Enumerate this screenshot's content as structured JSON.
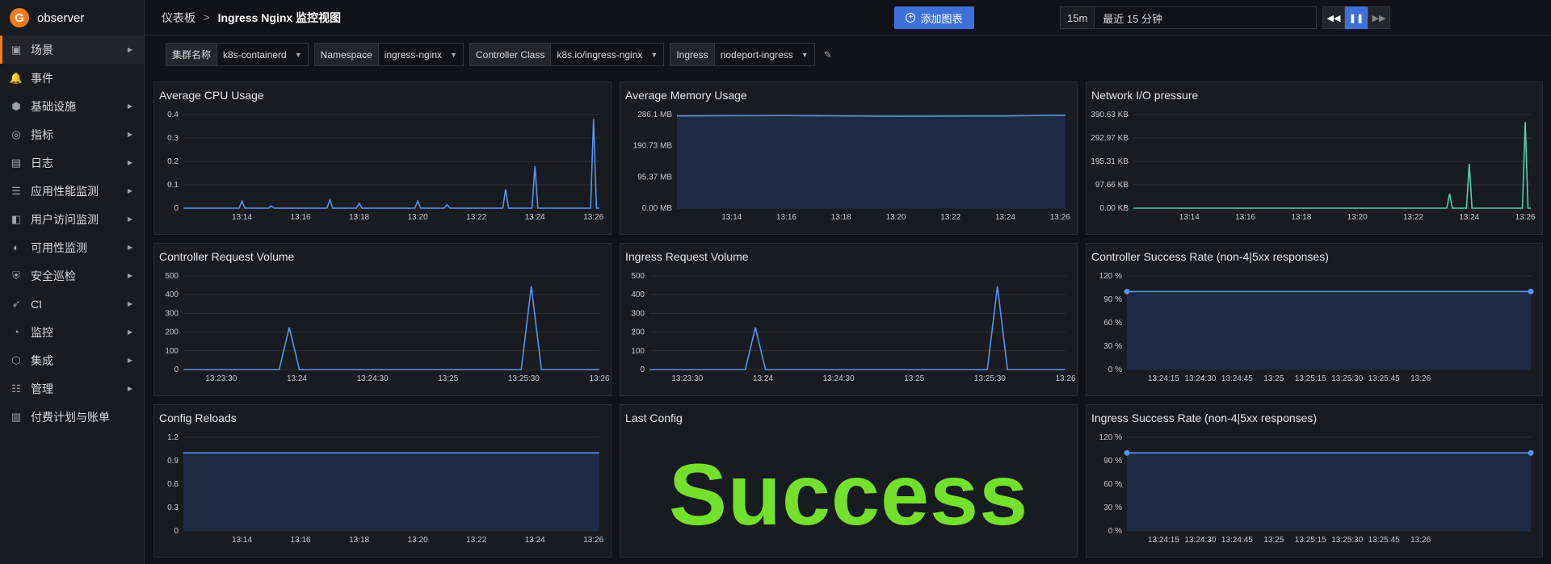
{
  "app": {
    "name": "observer",
    "logo_letter": "G"
  },
  "sidebar": {
    "items": [
      {
        "label": "场景",
        "icon": "scene-icon",
        "glyph": "▣",
        "caret": true,
        "active": true
      },
      {
        "label": "事件",
        "icon": "bell-icon",
        "glyph": "🔔",
        "caret": false
      },
      {
        "label": "基础设施",
        "icon": "infra-icon",
        "glyph": "⬢",
        "caret": true
      },
      {
        "label": "指标",
        "icon": "metrics-icon",
        "glyph": "◎",
        "caret": true
      },
      {
        "label": "日志",
        "icon": "log-icon",
        "glyph": "▤",
        "caret": true
      },
      {
        "label": "应用性能监测",
        "icon": "apm-icon",
        "glyph": "☰",
        "caret": true
      },
      {
        "label": "用户访问监测",
        "icon": "rum-icon",
        "glyph": "◧",
        "caret": true
      },
      {
        "label": "可用性监测",
        "icon": "availability-icon",
        "glyph": "◐",
        "caret": true
      },
      {
        "label": "安全巡检",
        "icon": "shield-icon",
        "glyph": "⛨",
        "caret": true
      },
      {
        "label": "CI",
        "icon": "rocket-icon",
        "glyph": "➶",
        "caret": true
      },
      {
        "label": "监控",
        "icon": "monitor-icon",
        "glyph": "◔",
        "caret": true
      },
      {
        "label": "集成",
        "icon": "integration-icon",
        "glyph": "⬡",
        "caret": true
      },
      {
        "label": "管理",
        "icon": "settings-sliders-icon",
        "glyph": "☷",
        "caret": true
      },
      {
        "label": "付费计划与账单",
        "icon": "billing-icon",
        "glyph": "▥",
        "caret": false
      }
    ]
  },
  "header": {
    "breadcrumb_root": "仪表板",
    "breadcrumb_sep": ">",
    "title": "Ingress Nginx 监控视图",
    "add_chart_label": "添加图表",
    "time_chip": "15m",
    "time_range": "最近 15 分钟"
  },
  "filters": [
    {
      "label": "集群名称",
      "value": "k8s-containerd"
    },
    {
      "label": "Namespace",
      "value": "ingress-nginx"
    },
    {
      "label": "Controller Class",
      "value": "k8s.io/ingress-nginx"
    },
    {
      "label": "Ingress",
      "value": "nodeport-ingress"
    }
  ],
  "colors": {
    "accent": "#3d71d9",
    "line_blue": "#5794f2",
    "line_teal": "#4fd1b0",
    "success": "#73e02b",
    "fill": "#1f2b47"
  },
  "panels": {
    "cpu": {
      "title": "Average CPU Usage"
    },
    "memory": {
      "title": "Average Memory Usage"
    },
    "network": {
      "title": "Network I/O pressure"
    },
    "controller_req": {
      "title": "Controller Request Volume"
    },
    "ingress_req": {
      "title": "Ingress Request Volume"
    },
    "controller_success": {
      "title": "Controller Success Rate (non-4|5xx responses)"
    },
    "config_reloads": {
      "title": "Config Reloads"
    },
    "last_config": {
      "title": "Last Config",
      "value": "Success"
    },
    "ingress_success": {
      "title": "Ingress Success Rate (non-4|5xx responses)"
    }
  },
  "chart_data": [
    {
      "id": "cpu",
      "type": "line",
      "title": "Average CPU Usage",
      "yticks": [
        "0",
        "0.1",
        "0.2",
        "0.3",
        "0.4"
      ],
      "ylim": [
        0,
        0.4
      ],
      "xticks": [
        "13:14",
        "13:16",
        "13:18",
        "13:20",
        "13:22",
        "13:24",
        "13:26"
      ],
      "xlim": [
        0,
        14.2
      ],
      "xtick_pos": [
        2,
        4,
        6,
        8,
        10,
        12,
        14
      ],
      "fill": false,
      "color": "#5794f2",
      "series": [
        {
          "x": [
            0,
            1.9,
            2.0,
            2.1,
            2.9,
            3.0,
            3.1,
            4.9,
            5.0,
            5.1,
            5.9,
            6.0,
            6.1,
            7.9,
            8.0,
            8.1,
            8.9,
            9.0,
            9.1,
            10.9,
            11.0,
            11.1,
            11.9,
            12.0,
            12.1,
            13.9,
            14.0,
            14.1,
            14.2
          ],
          "y": [
            0,
            0,
            0.03,
            0,
            0,
            0.01,
            0,
            0,
            0.035,
            0,
            0,
            0.02,
            0,
            0,
            0.03,
            0,
            0,
            0.015,
            0,
            0,
            0.08,
            0,
            0,
            0.18,
            0,
            0,
            0.38,
            0,
            0
          ]
        }
      ]
    },
    {
      "id": "memory",
      "type": "area",
      "title": "Average Memory Usage",
      "yticks": [
        "0.00 MB",
        "95.37 MB",
        "190.73 MB",
        "286.1 MB"
      ],
      "ylim": [
        0,
        286.1
      ],
      "xticks": [
        "13:14",
        "13:16",
        "13:18",
        "13:20",
        "13:22",
        "13:24",
        "13:26"
      ],
      "xlim": [
        0,
        14.2
      ],
      "xtick_pos": [
        2,
        4,
        6,
        8,
        10,
        12,
        14
      ],
      "fill": true,
      "color": "#5794f2",
      "series": [
        {
          "x": [
            0,
            4,
            8,
            12,
            14.2
          ],
          "y": [
            282,
            283,
            281,
            282,
            284
          ]
        }
      ]
    },
    {
      "id": "network",
      "type": "line",
      "title": "Network I/O pressure",
      "yticks": [
        "0.00 KB",
        "97.66 KB",
        "195.31 KB",
        "292.97 KB",
        "390.63 KB"
      ],
      "ylim": [
        0,
        390.63
      ],
      "xticks": [
        "13:14",
        "13:16",
        "13:18",
        "13:20",
        "13:22",
        "13:24",
        "13:26"
      ],
      "xlim": [
        0,
        14.2
      ],
      "xtick_pos": [
        2,
        4,
        6,
        8,
        10,
        12,
        14
      ],
      "fill": false,
      "color": "#4fd1b0",
      "series": [
        {
          "x": [
            0,
            11.2,
            11.3,
            11.4,
            11.9,
            12.0,
            12.1,
            13.9,
            14.0,
            14.1,
            14.2
          ],
          "y": [
            0,
            0,
            60,
            0,
            0,
            185,
            0,
            0,
            360,
            0,
            0
          ]
        }
      ]
    },
    {
      "id": "controller_req",
      "type": "line",
      "title": "Controller Request Volume",
      "yticks": [
        "0",
        "100",
        "200",
        "300",
        "400",
        "500"
      ],
      "ylim": [
        0,
        500
      ],
      "xticks": [
        "13:23:30",
        "13:24",
        "13:24:30",
        "13:25",
        "13:25:30",
        "13:26"
      ],
      "xlim": [
        0,
        165
      ],
      "xtick_pos": [
        15,
        45,
        75,
        105,
        135,
        165
      ],
      "fill": false,
      "color": "#5794f2",
      "series": [
        {
          "x": [
            0,
            38,
            42,
            46,
            134,
            138,
            142,
            165
          ],
          "y": [
            0,
            0,
            225,
            0,
            0,
            445,
            0,
            0
          ]
        }
      ]
    },
    {
      "id": "ingress_req",
      "type": "line",
      "title": "Ingress Request Volume",
      "yticks": [
        "0",
        "100",
        "200",
        "300",
        "400",
        "500"
      ],
      "ylim": [
        0,
        500
      ],
      "xticks": [
        "13:23:30",
        "13:24",
        "13:24:30",
        "13:25",
        "13:25:30",
        "13:26"
      ],
      "xlim": [
        0,
        165
      ],
      "xtick_pos": [
        15,
        45,
        75,
        105,
        135,
        165
      ],
      "fill": false,
      "color": "#5794f2",
      "series": [
        {
          "x": [
            0,
            38,
            42,
            46,
            134,
            138,
            142,
            165
          ],
          "y": [
            0,
            0,
            225,
            0,
            0,
            445,
            0,
            0
          ]
        }
      ]
    },
    {
      "id": "controller_success",
      "type": "area",
      "title": "Controller Success Rate (non-4|5xx responses)",
      "yticks": [
        "0 %",
        "30 %",
        "60 %",
        "90 %",
        "120 %"
      ],
      "ylim": [
        0,
        120
      ],
      "xticks": [
        "13:24:15",
        "13:24:30",
        "13:24:45",
        "13:25",
        "13:25:15",
        "13:25:30",
        "13:25:45",
        "13:26"
      ],
      "xlim": [
        0,
        165
      ],
      "xtick_pos": [
        15,
        30,
        45,
        60,
        75,
        90,
        105,
        120
      ],
      "fill": true,
      "color": "#5794f2",
      "points": true,
      "series": [
        {
          "x": [
            0,
            165
          ],
          "y": [
            100,
            100
          ]
        }
      ]
    },
    {
      "id": "config_reloads",
      "type": "area",
      "title": "Config Reloads",
      "yticks": [
        "0",
        "0.3",
        "0.6",
        "0.9",
        "1.2"
      ],
      "ylim": [
        0,
        1.2
      ],
      "xticks": [
        "13:14",
        "13:16",
        "13:18",
        "13:20",
        "13:22",
        "13:24",
        "13:26"
      ],
      "xlim": [
        0,
        14.2
      ],
      "xtick_pos": [
        2,
        4,
        6,
        8,
        10,
        12,
        14
      ],
      "fill": true,
      "color": "#5794f2",
      "series": [
        {
          "x": [
            0,
            14.2
          ],
          "y": [
            1,
            1
          ]
        }
      ]
    },
    {
      "id": "ingress_success",
      "type": "area",
      "title": "Ingress Success Rate (non-4|5xx responses)",
      "yticks": [
        "0 %",
        "30 %",
        "60 %",
        "90 %",
        "120 %"
      ],
      "ylim": [
        0,
        120
      ],
      "xticks": [
        "13:24:15",
        "13:24:30",
        "13:24:45",
        "13:25",
        "13:25:15",
        "13:25:30",
        "13:25:45",
        "13:26"
      ],
      "xlim": [
        0,
        165
      ],
      "xtick_pos": [
        15,
        30,
        45,
        60,
        75,
        90,
        105,
        120
      ],
      "fill": true,
      "color": "#5794f2",
      "points": true,
      "series": [
        {
          "x": [
            0,
            165
          ],
          "y": [
            100,
            100
          ]
        }
      ]
    }
  ]
}
